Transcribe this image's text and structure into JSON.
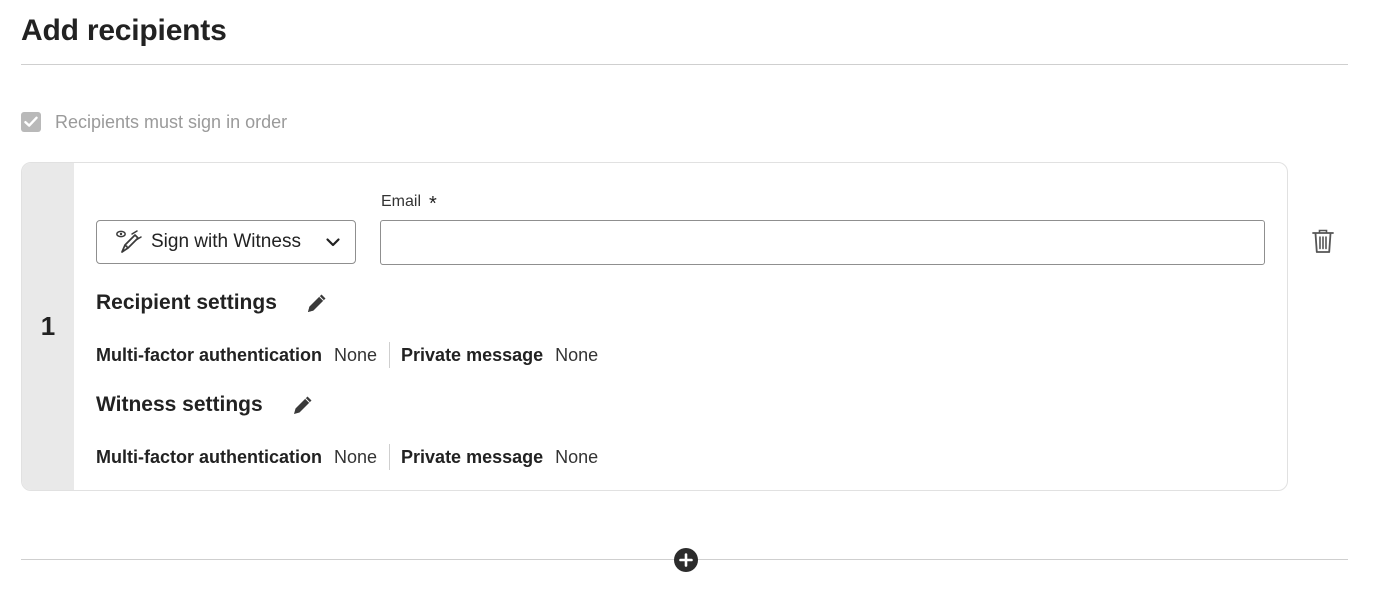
{
  "page": {
    "title": "Add recipients"
  },
  "order": {
    "label": "Recipients must sign in order",
    "checked": true
  },
  "recipients": [
    {
      "number": "1",
      "role": {
        "label": "Sign with Witness",
        "icon": "sign-with-witness-icon"
      },
      "email": {
        "label": "Email",
        "required_mark": "*",
        "value": "",
        "placeholder": ""
      },
      "recipient_settings": {
        "title": "Recipient settings",
        "mfa_label": "Multi-factor authentication",
        "mfa_value": "None",
        "private_message_label": "Private message",
        "private_message_value": "None"
      },
      "witness_settings": {
        "title": "Witness settings",
        "mfa_label": "Multi-factor authentication",
        "mfa_value": "None",
        "private_message_label": "Private message",
        "private_message_value": "None"
      }
    }
  ],
  "icons": {
    "delete": "trash-icon",
    "add": "plus-circle-icon",
    "edit": "pencil-icon",
    "dropdown": "chevron-down-icon"
  },
  "colors": {
    "text": "#222222",
    "muted": "#9a9a9a",
    "rail": "#e9e9e9",
    "border": "#8f8f8f"
  }
}
